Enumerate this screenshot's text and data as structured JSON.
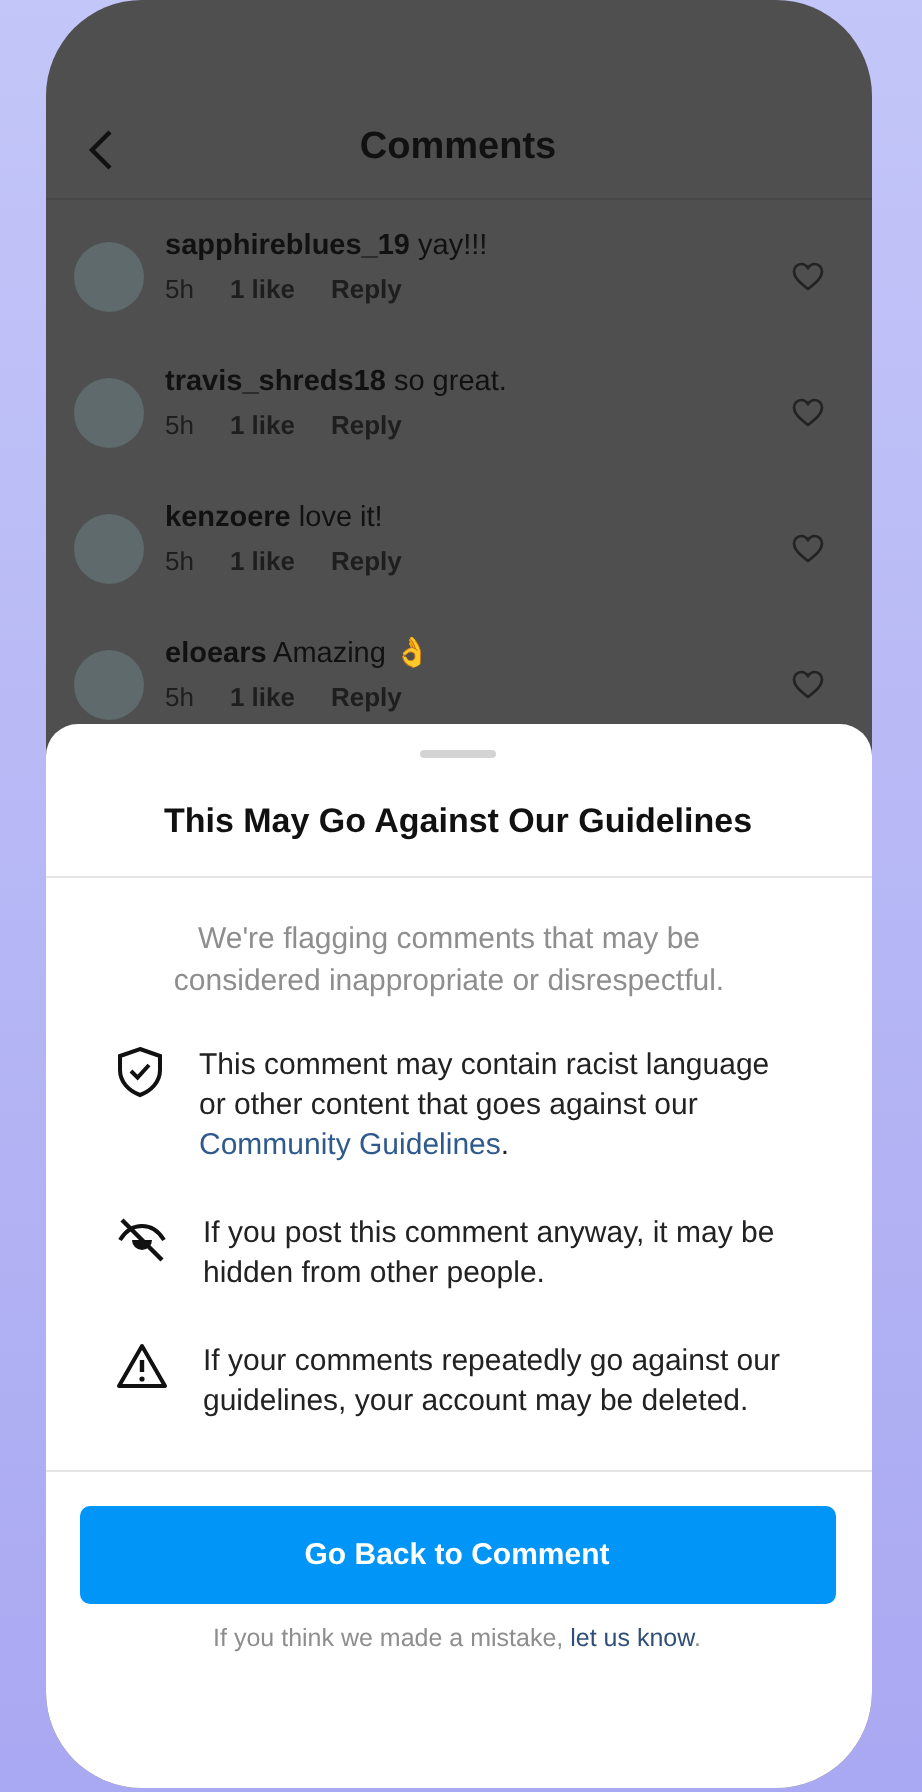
{
  "header": {
    "title": "Comments"
  },
  "comments": [
    {
      "username": "sapphireblues_19",
      "text": "yay!!!",
      "time": "5h",
      "likes": "1 like",
      "reply": "Reply"
    },
    {
      "username": "travis_shreds18",
      "text": "so great.",
      "time": "5h",
      "likes": "1 like",
      "reply": "Reply"
    },
    {
      "username": "kenzoere",
      "text": "love it!",
      "time": "5h",
      "likes": "1 like",
      "reply": "Reply"
    },
    {
      "username": "eloears",
      "text": "Amazing 👌",
      "time": "5h",
      "likes": "1 like",
      "reply": "Reply"
    }
  ],
  "sheet": {
    "title": "This May Go Against Our Guidelines",
    "intro": "We're flagging comments that may be considered inappropriate or disrespectful.",
    "points": [
      {
        "kind": "shield",
        "text": "This comment may contain racist language or other content that goes against our ",
        "link": "Community Guidelines",
        "after": "."
      },
      {
        "kind": "hidden",
        "text": "If you post this comment anyway, it may be hidden from other people."
      },
      {
        "kind": "warning",
        "text": "If your comments repeatedly go against our guidelines, your account may be deleted."
      }
    ],
    "button": "Go Back to Comment",
    "footer": {
      "text": "If you think we made a mistake, ",
      "link": "let us know",
      "after": "."
    }
  }
}
